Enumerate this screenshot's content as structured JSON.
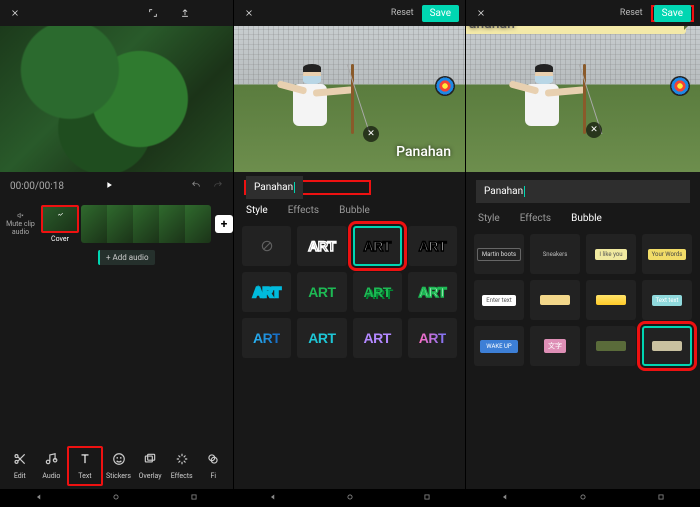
{
  "panel1": {
    "time_current": "00:00",
    "time_total": "00:18",
    "mute_label": "Mute clip audio",
    "cover_label": "Cover",
    "add_audio": "+ Add audio",
    "toolbar": [
      {
        "icon": "scissors",
        "label": "Edit"
      },
      {
        "icon": "audio",
        "label": "Audio"
      },
      {
        "icon": "text",
        "label": "Text"
      },
      {
        "icon": "smiley",
        "label": "Stickers"
      },
      {
        "icon": "overlay",
        "label": "Overlay"
      },
      {
        "icon": "sparkle",
        "label": "Effects"
      },
      {
        "icon": "filter",
        "label": "Fi"
      }
    ]
  },
  "panel2": {
    "reset": "Reset",
    "save": "Save",
    "overlay_text": "Panahan",
    "input_value": "Panahan",
    "tabs": [
      "Style",
      "Effects",
      "Bubble"
    ],
    "styles": [
      {
        "none": true
      },
      {
        "text": "ART",
        "stroke": "#fff",
        "fill": "#000"
      },
      {
        "text": "ART",
        "stroke": "#000",
        "fill": "#fff",
        "selected": true,
        "highlight": true
      },
      {
        "text": "ART",
        "stroke": "#000",
        "fill": "#fff",
        "bold": true
      },
      {
        "text": "ART",
        "fill": "#fff",
        "stroke": "#0bd",
        "thick": true
      },
      {
        "text": "ART",
        "fill": "#1db954"
      },
      {
        "text": "ART",
        "fill": "#1db954",
        "shadow": "#083"
      },
      {
        "text": "ART",
        "fill": "#fff",
        "stroke": "#1db954"
      },
      {
        "text": "ART",
        "grad": [
          "#29b6f6",
          "#1565c0"
        ]
      },
      {
        "text": "ART",
        "fill": "#1ec6d6"
      },
      {
        "text": "ART",
        "fill": "#b388ff"
      },
      {
        "text": "ART",
        "grad": [
          "#ff6ec4",
          "#7873f5"
        ]
      }
    ]
  },
  "panel3": {
    "reset": "Reset",
    "save": "Save",
    "overlay_text": "Panahan",
    "input_value": "Panahan",
    "tabs": [
      "Style",
      "Effects",
      "Bubble"
    ],
    "bubbles": [
      {
        "label": "Martin boots",
        "cls": "bub1"
      },
      {
        "label": "Sneakers",
        "cls": "bub2"
      },
      {
        "label": "I like you",
        "cls": "bub3"
      },
      {
        "label": "Your Words",
        "cls": "bub4"
      },
      {
        "label": "Enter text",
        "cls": "bub5"
      },
      {
        "label": "",
        "cls": "bub6"
      },
      {
        "label": "",
        "cls": "bub7"
      },
      {
        "label": "Text text",
        "cls": "bub8"
      },
      {
        "label": "WAKE UP",
        "cls": "bub9"
      },
      {
        "label": "文字",
        "cls": "bub10"
      },
      {
        "label": "",
        "cls": "bub11"
      },
      {
        "label": "",
        "cls": "bub12",
        "highlight": true
      }
    ]
  }
}
